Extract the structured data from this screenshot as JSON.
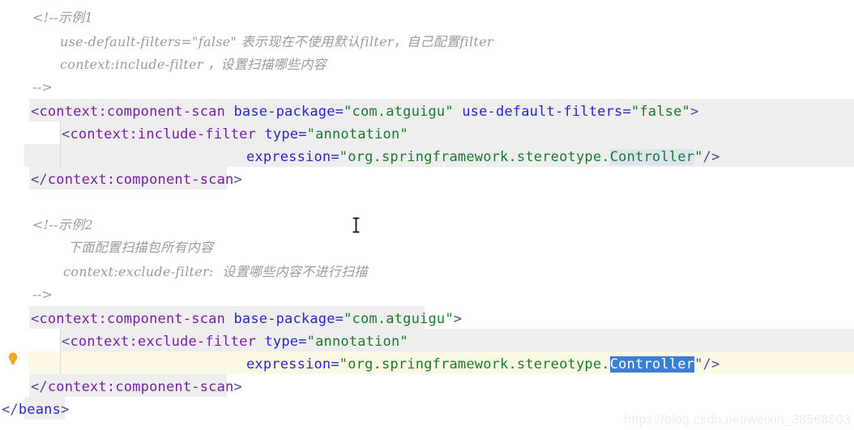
{
  "app": {
    "kind": "xml-code-editor",
    "watermark": "https://blog.csdn.net/weixin_38568503"
  },
  "colors": {
    "background": "#ffffff",
    "tag": "#7b1fa2",
    "punctuation": "#4b4b8f",
    "attribute": "#2828c8",
    "value": "#1a7a2e",
    "comment": "#9a9a9a",
    "line_highlight_grey": "#eeeeee",
    "caret_line_yellow": "#fdf8e3",
    "soft_occurrence_highlight": "#dfe5f0",
    "selection_blue": "#3b7fd4",
    "indent_guide": "#d8d8dd",
    "bulb_yellow": "#f5a623",
    "watermark": "#ececec"
  },
  "icons": {
    "lightbulb": "intention-action-lightbulb",
    "text_cursor": "i-beam-mouse-pointer"
  },
  "comment_block_1": {
    "open": "<!--示例1",
    "line_2": "use-default-filters=\"false\" 表示现在不使用默认filter，自己配置filter",
    "line_3": "context:include-filter ，设置扫描哪些内容",
    "close": "-->"
  },
  "comment_block_2": {
    "open": "<!--示例2",
    "line_2": "下面配置扫描包所有内容",
    "line_3": "context:exclude-filter:  设置哪些内容不进行扫描",
    "close": "-->"
  },
  "code_block_1": {
    "line_1": {
      "open_bracket": "<",
      "tag": "context:component-scan",
      "attr1_name": "base-package",
      "attr1_eq": "=",
      "attr1_value": "\"com.atguigu\"",
      "attr2_name": "use-default-filters",
      "attr2_eq": "=",
      "attr2_value": "\"false\"",
      "close_bracket": ">"
    },
    "line_2": {
      "open_bracket": "<",
      "tag": "context:include-filter",
      "attr_name": "type",
      "attr_eq": "=",
      "attr_value": "\"annotation\""
    },
    "line_3": {
      "attr_name": "expression",
      "attr_eq": "=",
      "value_open_quote": "\"",
      "value_prefix": "org.springframework.stereotype.",
      "value_highlight": "Controller",
      "value_close_quote": "\"",
      "self_close": "/>"
    },
    "line_4": {
      "open": "</",
      "tag": "context:component-scan",
      "close": ">"
    }
  },
  "code_block_2": {
    "line_1": {
      "open_bracket": "<",
      "tag": "context:component-scan",
      "attr1_name": "base-package",
      "attr1_eq": "=",
      "attr1_value": "\"com.atguigu\"",
      "close_bracket": ">"
    },
    "line_2": {
      "open_bracket": "<",
      "tag": "context:exclude-filter",
      "attr_name": "type",
      "attr_eq": "=",
      "attr_value": "\"annotation\""
    },
    "line_3": {
      "attr_name": "expression",
      "attr_eq": "=",
      "value_open_quote": "\"",
      "value_prefix": "org.springframework.stereotype.",
      "value_selected": "Controller",
      "value_close_quote": "\"",
      "self_close": "/>"
    },
    "line_4": {
      "open": "</",
      "tag": "context:component-scan",
      "close": ">"
    }
  },
  "closing": {
    "open": "</",
    "tag": "beans",
    "close": ">"
  }
}
